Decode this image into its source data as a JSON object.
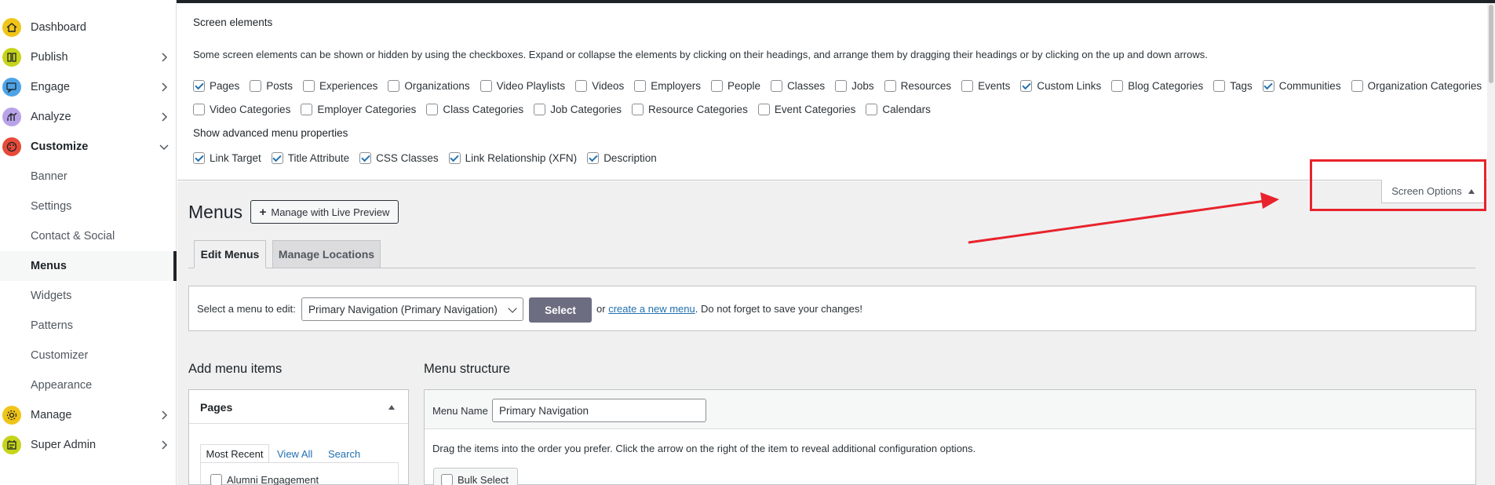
{
  "sidebar": {
    "items": [
      {
        "label": "Dashboard",
        "icon": "home-icon",
        "color": "#f0c419"
      },
      {
        "label": "Publish",
        "icon": "publish-icon",
        "color": "#c6d41c"
      },
      {
        "label": "Engage",
        "icon": "engage-icon",
        "color": "#4da3e6"
      },
      {
        "label": "Analyze",
        "icon": "analyze-icon",
        "color": "#b9a3e8"
      },
      {
        "label": "Customize",
        "icon": "customize-icon",
        "color": "#e84a3a"
      }
    ],
    "subitems": [
      "Banner",
      "Settings",
      "Contact & Social",
      "Menus",
      "Widgets",
      "Patterns",
      "Customizer",
      "Appearance"
    ],
    "bottom": [
      {
        "label": "Manage",
        "icon": "manage-icon",
        "color": "#f0c419"
      },
      {
        "label": "Super Admin",
        "icon": "super-admin-icon",
        "color": "#c6d41c"
      }
    ]
  },
  "screen_options": {
    "title": "Screen elements",
    "description": "Some screen elements can be shown or hidden by using the checkboxes. Expand or collapse the elements by clicking on their headings, and arrange them by dragging their headings or by clicking on the up and down arrows.",
    "row1": [
      {
        "label": "Pages",
        "checked": true
      },
      {
        "label": "Posts",
        "checked": false
      },
      {
        "label": "Experiences",
        "checked": false
      },
      {
        "label": "Organizations",
        "checked": false
      },
      {
        "label": "Video Playlists",
        "checked": false
      },
      {
        "label": "Videos",
        "checked": false
      },
      {
        "label": "Employers",
        "checked": false
      },
      {
        "label": "People",
        "checked": false
      },
      {
        "label": "Classes",
        "checked": false
      },
      {
        "label": "Jobs",
        "checked": false
      },
      {
        "label": "Resources",
        "checked": false
      },
      {
        "label": "Events",
        "checked": false
      },
      {
        "label": "Custom Links",
        "checked": true
      },
      {
        "label": "Blog Categories",
        "checked": false
      },
      {
        "label": "Tags",
        "checked": false
      },
      {
        "label": "Communities",
        "checked": true
      },
      {
        "label": "Organization Categories",
        "checked": false
      }
    ],
    "row2": [
      {
        "label": "Video Categories",
        "checked": false
      },
      {
        "label": "Employer Categories",
        "checked": false
      },
      {
        "label": "Class Categories",
        "checked": false
      },
      {
        "label": "Job Categories",
        "checked": false
      },
      {
        "label": "Resource Categories",
        "checked": false
      },
      {
        "label": "Event Categories",
        "checked": false
      },
      {
        "label": "Calendars",
        "checked": false
      }
    ],
    "advanced_title": "Show advanced menu properties",
    "advanced": [
      {
        "label": "Link Target",
        "checked": true
      },
      {
        "label": "Title Attribute",
        "checked": true
      },
      {
        "label": "CSS Classes",
        "checked": true
      },
      {
        "label": "Link Relationship (XFN)",
        "checked": true
      },
      {
        "label": "Description",
        "checked": true
      }
    ],
    "toggle_label": "Screen Options"
  },
  "main": {
    "title": "Menus",
    "live_preview": "Manage with Live Preview",
    "tabs": [
      "Edit Menus",
      "Manage Locations"
    ],
    "select_label": "Select a menu to edit:",
    "select_value": "Primary Navigation (Primary Navigation)",
    "select_button": "Select",
    "or_text": "or",
    "create_link": "create a new menu",
    "save_note": ". Do not forget to save your changes!",
    "add_items_title": "Add menu items",
    "pages_title": "Pages",
    "pages_tabs": [
      "Most Recent",
      "View All",
      "Search"
    ],
    "first_page": "Alumni Engagement",
    "structure_title": "Menu structure",
    "menu_name_label": "Menu Name",
    "menu_name_value": "Primary Navigation",
    "drag_help": "Drag the items into the order you prefer. Click the arrow on the right of the item to reveal additional configuration options.",
    "bulk_select": "Bulk Select"
  },
  "colors": {
    "accent": "#2271b1",
    "annotation": "#e8232b",
    "select_button": "#6c6d80"
  }
}
